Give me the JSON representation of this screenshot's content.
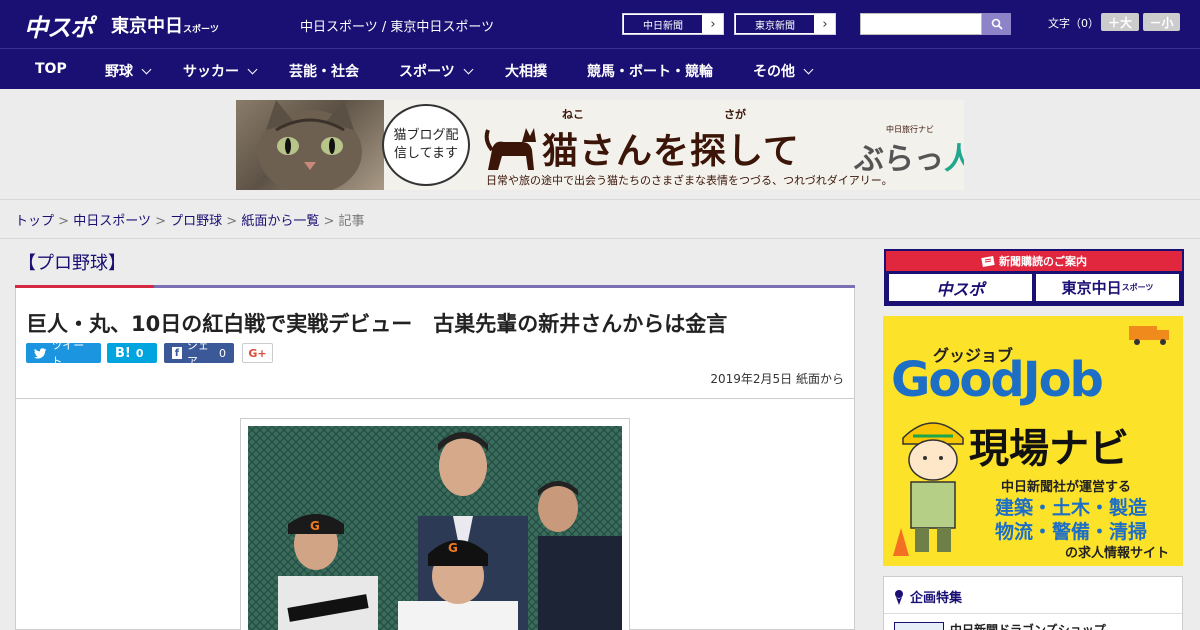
{
  "header": {
    "logo_main": "中スポ",
    "logo_tokyo": "東京中日",
    "logo_tokyo_suffix": "スポーツ",
    "site_title": "中日スポーツ / 東京中日スポーツ",
    "link_chunichi": "中日新聞",
    "link_tokyo": "東京新聞",
    "search_placeholder": "",
    "fontsize_label": "文字（0）",
    "fontsize_plus": "＋大",
    "fontsize_minus": "－小"
  },
  "nav": [
    {
      "label": "TOP",
      "has_menu": false
    },
    {
      "label": "野球",
      "has_menu": true
    },
    {
      "label": "サッカー",
      "has_menu": true
    },
    {
      "label": "芸能・社会",
      "has_menu": false
    },
    {
      "label": "スポーツ",
      "has_menu": true
    },
    {
      "label": "大相撲",
      "has_menu": false
    },
    {
      "label": "競馬・ボート・競輪",
      "has_menu": false
    },
    {
      "label": "その他",
      "has_menu": true
    }
  ],
  "banner": {
    "speech": "猫ブログ配信してます",
    "ruby_neko": "ねこ",
    "ruby_saga": "さが",
    "title": "猫さんを探して",
    "subtitle": "日常や旅の途中で出会う猫たちのさまざまな表情をつづる、つれづれダイアリー。",
    "navi_small": "中日旅行ナビ",
    "navi_brand": "ぶらっ",
    "navi_brand_accent": "人"
  },
  "breadcrumb": {
    "items": [
      "トップ",
      "中日スポーツ",
      "プロ野球",
      "紙面から一覧"
    ],
    "current": "記事",
    "separator": ">"
  },
  "article": {
    "category": "【プロ野球】",
    "headline": "巨人・丸、10日の紅白戦で実戦デビュー　古巣先輩の新井さんからは金言",
    "date": "2019年2月5日 紙面から",
    "share": {
      "tweet": "ツイート",
      "hatena": "B!",
      "hatena_count": "0",
      "fb": "シェア",
      "fb_count": "0",
      "gplus": "G+"
    }
  },
  "sidebar": {
    "subscribe_head": "新聞購読のご案内",
    "subscribe_logo1": "中スポ",
    "subscribe_logo2": "東京中日",
    "subscribe_logo2_suffix": "スポーツ",
    "goodjob_ruby": "グッジョブ",
    "goodjob_title": "GoodJob",
    "goodjob_navi": "現場ナビ",
    "goodjob_line1": "中日新聞社が運営する",
    "goodjob_line2": "建築・土木・製造",
    "goodjob_line3": "物流・警備・清掃",
    "goodjob_line4": "の求人情報サイト",
    "feature_title": "企画特集",
    "feature_item": "中日新聞ドラゴンズショップ"
  },
  "colors": {
    "brand_navy": "#1a0f73",
    "accent_red": "#d62a43",
    "twitter": "#1b95e0",
    "hatena": "#00a4de",
    "facebook": "#3b5998"
  }
}
